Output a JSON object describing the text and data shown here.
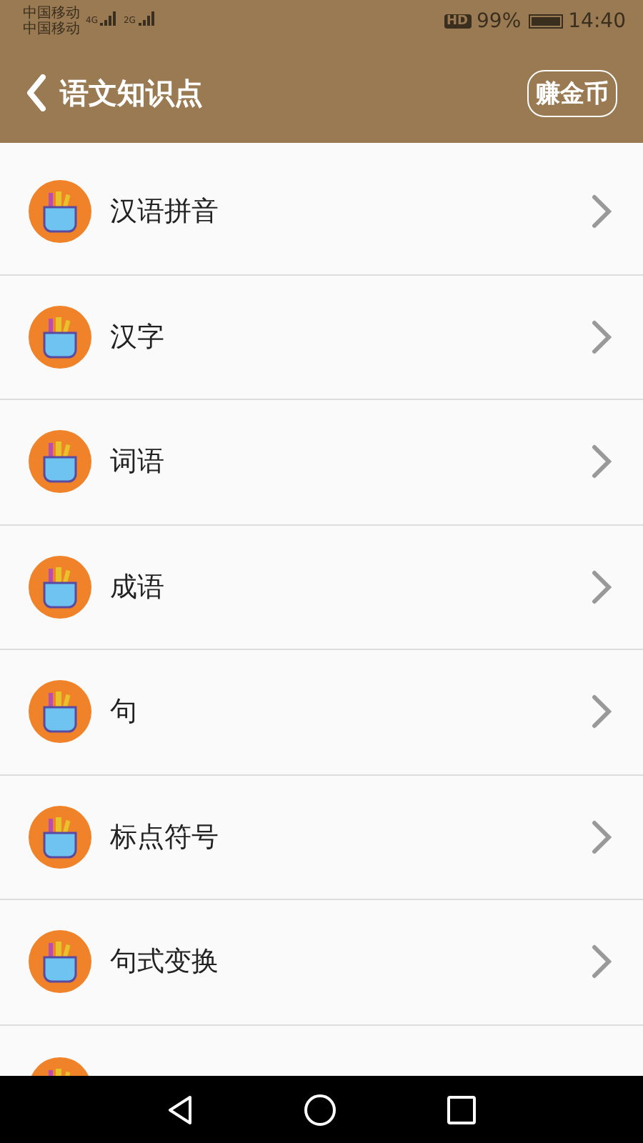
{
  "status_bar": {
    "carriers": [
      {
        "name": "中国移动",
        "network": "4G"
      },
      {
        "name": "中国移动",
        "network": "2G"
      }
    ],
    "hd": "HD",
    "battery": "99%",
    "time": "14:40"
  },
  "header": {
    "back": true,
    "title": "语文知识点",
    "action": "赚金币"
  },
  "items": [
    {
      "label": "汉语拼音"
    },
    {
      "label": "汉字"
    },
    {
      "label": "词语"
    },
    {
      "label": "成语"
    },
    {
      "label": "句"
    },
    {
      "label": "标点符号"
    },
    {
      "label": "句式变换"
    }
  ],
  "more_below": true
}
